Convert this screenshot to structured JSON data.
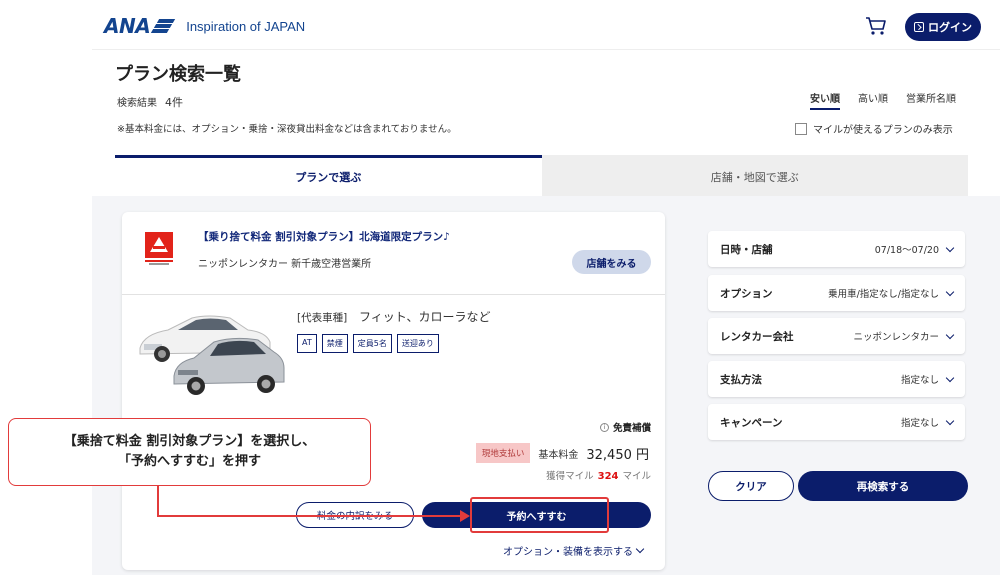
{
  "header": {
    "logo_text": "ANA",
    "tagline": "Inspiration of JAPAN",
    "login_label": "ログイン"
  },
  "page": {
    "title": "プラン検索一覧",
    "result_label": "検索結果",
    "result_count": "4件",
    "note": "※基本料金には、オプション・乗捨・深夜貸出料金などは含まれておりません。",
    "sort_options": [
      "安い順",
      "高い順",
      "営業所名順"
    ],
    "mile_filter_label": "マイルが使えるプランのみ表示"
  },
  "tabs": {
    "plan": "プランで選ぶ",
    "map": "店舗・地図で選ぶ"
  },
  "plan": {
    "title": "【乗り捨て料金 割引対象プラン】北海道限定プラン♪",
    "company": "ニッポンレンタカー 新千歳空港営業所",
    "store_button": "店舗をみる",
    "vehicle_bracket": "[代表車種]",
    "vehicle_names": "フィット、カローラなど",
    "badges": [
      "AT",
      "禁煙",
      "定員5名",
      "送迎あり"
    ],
    "exemption": "免責補償",
    "payment_badge": "現地支払い",
    "price_label": "基本料金",
    "price": "32,450 円",
    "miles_label": "獲得マイル",
    "miles_value": "324",
    "miles_unit": "マイル",
    "breakdown_button": "料金の内訳をみる",
    "reserve_button": "予約へすすむ",
    "options_link": "オプション・装備を表示する"
  },
  "filters": [
    {
      "label": "日時・店舗",
      "value": "07/18〜07/20"
    },
    {
      "label": "オプション",
      "value": "乗用車/指定なし/指定なし"
    },
    {
      "label": "レンタカー会社",
      "value": "ニッポンレンタカー"
    },
    {
      "label": "支払方法",
      "value": "指定なし"
    },
    {
      "label": "キャンペーン",
      "value": "指定なし"
    }
  ],
  "actions": {
    "clear": "クリア",
    "research": "再検索する"
  },
  "annotation": {
    "line1": "【乗捨て料金 割引対象プラン】を選択し、",
    "line2": "「予約へすすむ」を押す"
  },
  "colors": {
    "brand_navy": "#0b1d6b",
    "ana_blue": "#13448f",
    "annotation_red": "#e23b3b",
    "miles_red": "#dd1111"
  }
}
